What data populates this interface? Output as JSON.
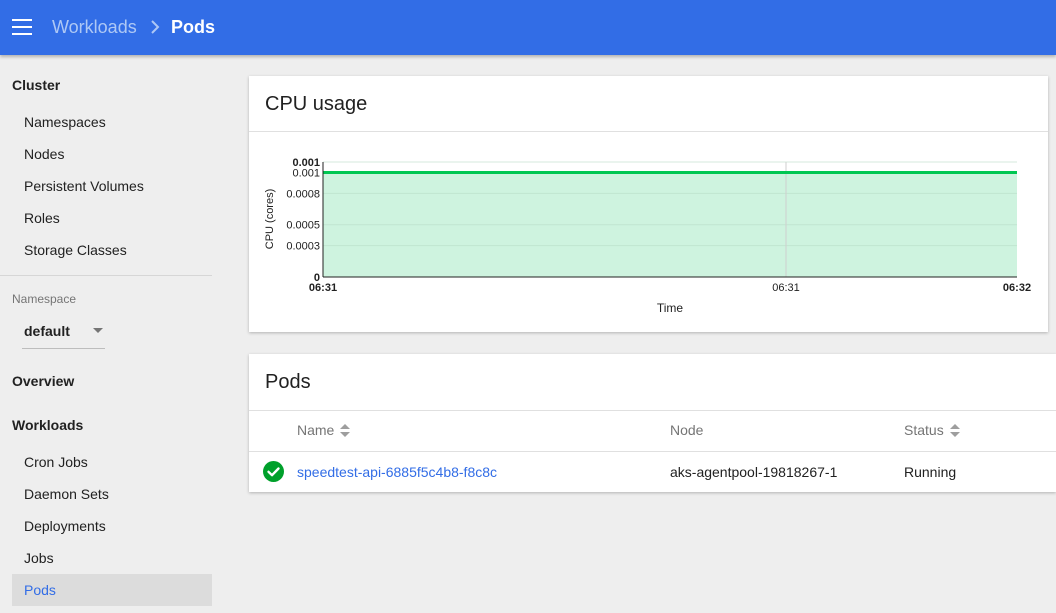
{
  "header": {
    "breadcrumb_parent": "Workloads",
    "breadcrumb_current": "Pods",
    "color": "#326de6"
  },
  "sidebar": {
    "cluster_header": "Cluster",
    "cluster_items": [
      "Namespaces",
      "Nodes",
      "Persistent Volumes",
      "Roles",
      "Storage Classes"
    ],
    "namespace_label": "Namespace",
    "namespace_value": "default",
    "overview": "Overview",
    "workloads_header": "Workloads",
    "workload_items": [
      "Cron Jobs",
      "Daemon Sets",
      "Deployments",
      "Jobs",
      "Pods"
    ],
    "active_item": "Pods"
  },
  "cpu_card": {
    "title": "CPU usage"
  },
  "chart_data": {
    "type": "area",
    "ylabel": "CPU (cores)",
    "xlabel": "Time",
    "y_ticks": [
      "0",
      "0.0003",
      "0.0005",
      "0.0008",
      "0.001",
      "0.001"
    ],
    "x_ticks": [
      "06:31",
      "06:31",
      "06:32"
    ],
    "ylim": [
      0,
      0.0011
    ],
    "series": [
      {
        "x": [
          "06:31",
          "06:32"
        ],
        "values": [
          0.001,
          0.001
        ]
      }
    ],
    "line_color": "#00c752",
    "fill_color": "#cef3df",
    "grid": true
  },
  "pods_card": {
    "title": "Pods",
    "columns": {
      "name": "Name",
      "node": "Node",
      "status": "Status"
    },
    "rows": [
      {
        "name": "speedtest-api-6885f5c4b8-f8c8c",
        "node": "aks-agentpool-19818267-1",
        "status": "Running",
        "status_color": "#00a02b"
      }
    ]
  }
}
